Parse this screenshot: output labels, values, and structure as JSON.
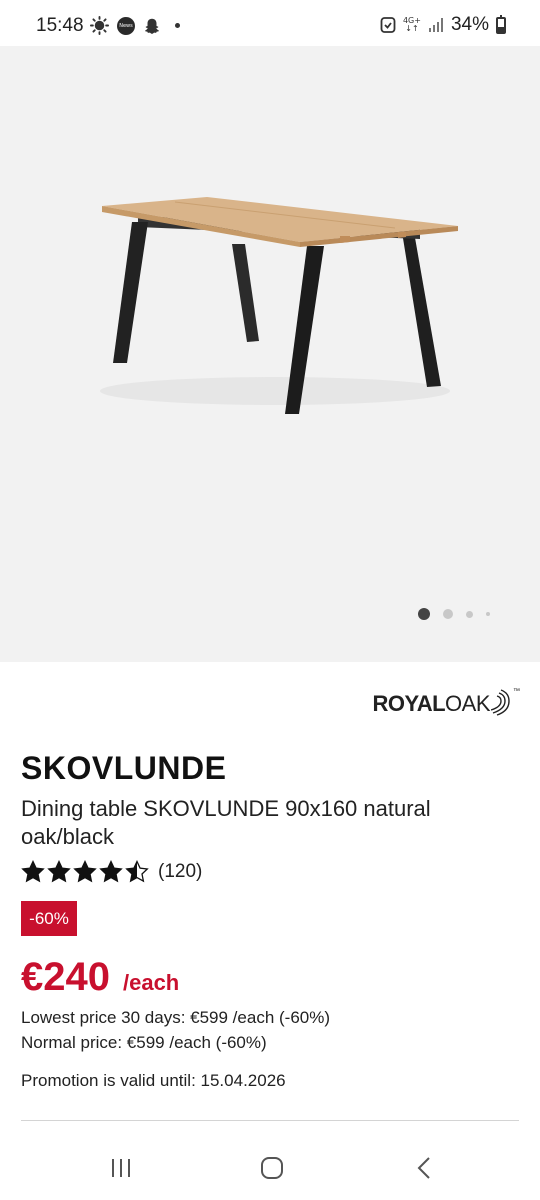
{
  "status_bar": {
    "time": "15:48",
    "icons": [
      "sun-icon",
      "news-icon",
      "snapchat-icon",
      "notification-dot-icon"
    ],
    "news_label": "News",
    "network": "4G+",
    "battery_percent": "34%",
    "battery_level": 0.34
  },
  "product_image": {
    "carousel": {
      "count": 4,
      "active_index": 0
    }
  },
  "product": {
    "brand": {
      "part1": "ROYAL",
      "part2": "OAK",
      "tm": "™"
    },
    "name": "SKOVLUNDE",
    "description": "Dining table SKOVLUNDE 90x160 natural oak/black",
    "rating": {
      "stars": 4.5,
      "count_text": "(120)"
    },
    "discount": "-60%",
    "price": {
      "amount": "€240",
      "unit": "/each"
    },
    "lowest_price": "Lowest price 30 days: €599 /each (-60%)",
    "normal_price": "Normal price: €599 /each (-60%)",
    "promotion": "Promotion is valid until: 15.04.2026"
  },
  "colors": {
    "accent_red": "#c8102e",
    "image_background": "#f2f2f2",
    "text": "#111111"
  },
  "nav_bar": {
    "buttons": [
      "recent-apps-icon",
      "home-icon",
      "back-icon"
    ]
  }
}
